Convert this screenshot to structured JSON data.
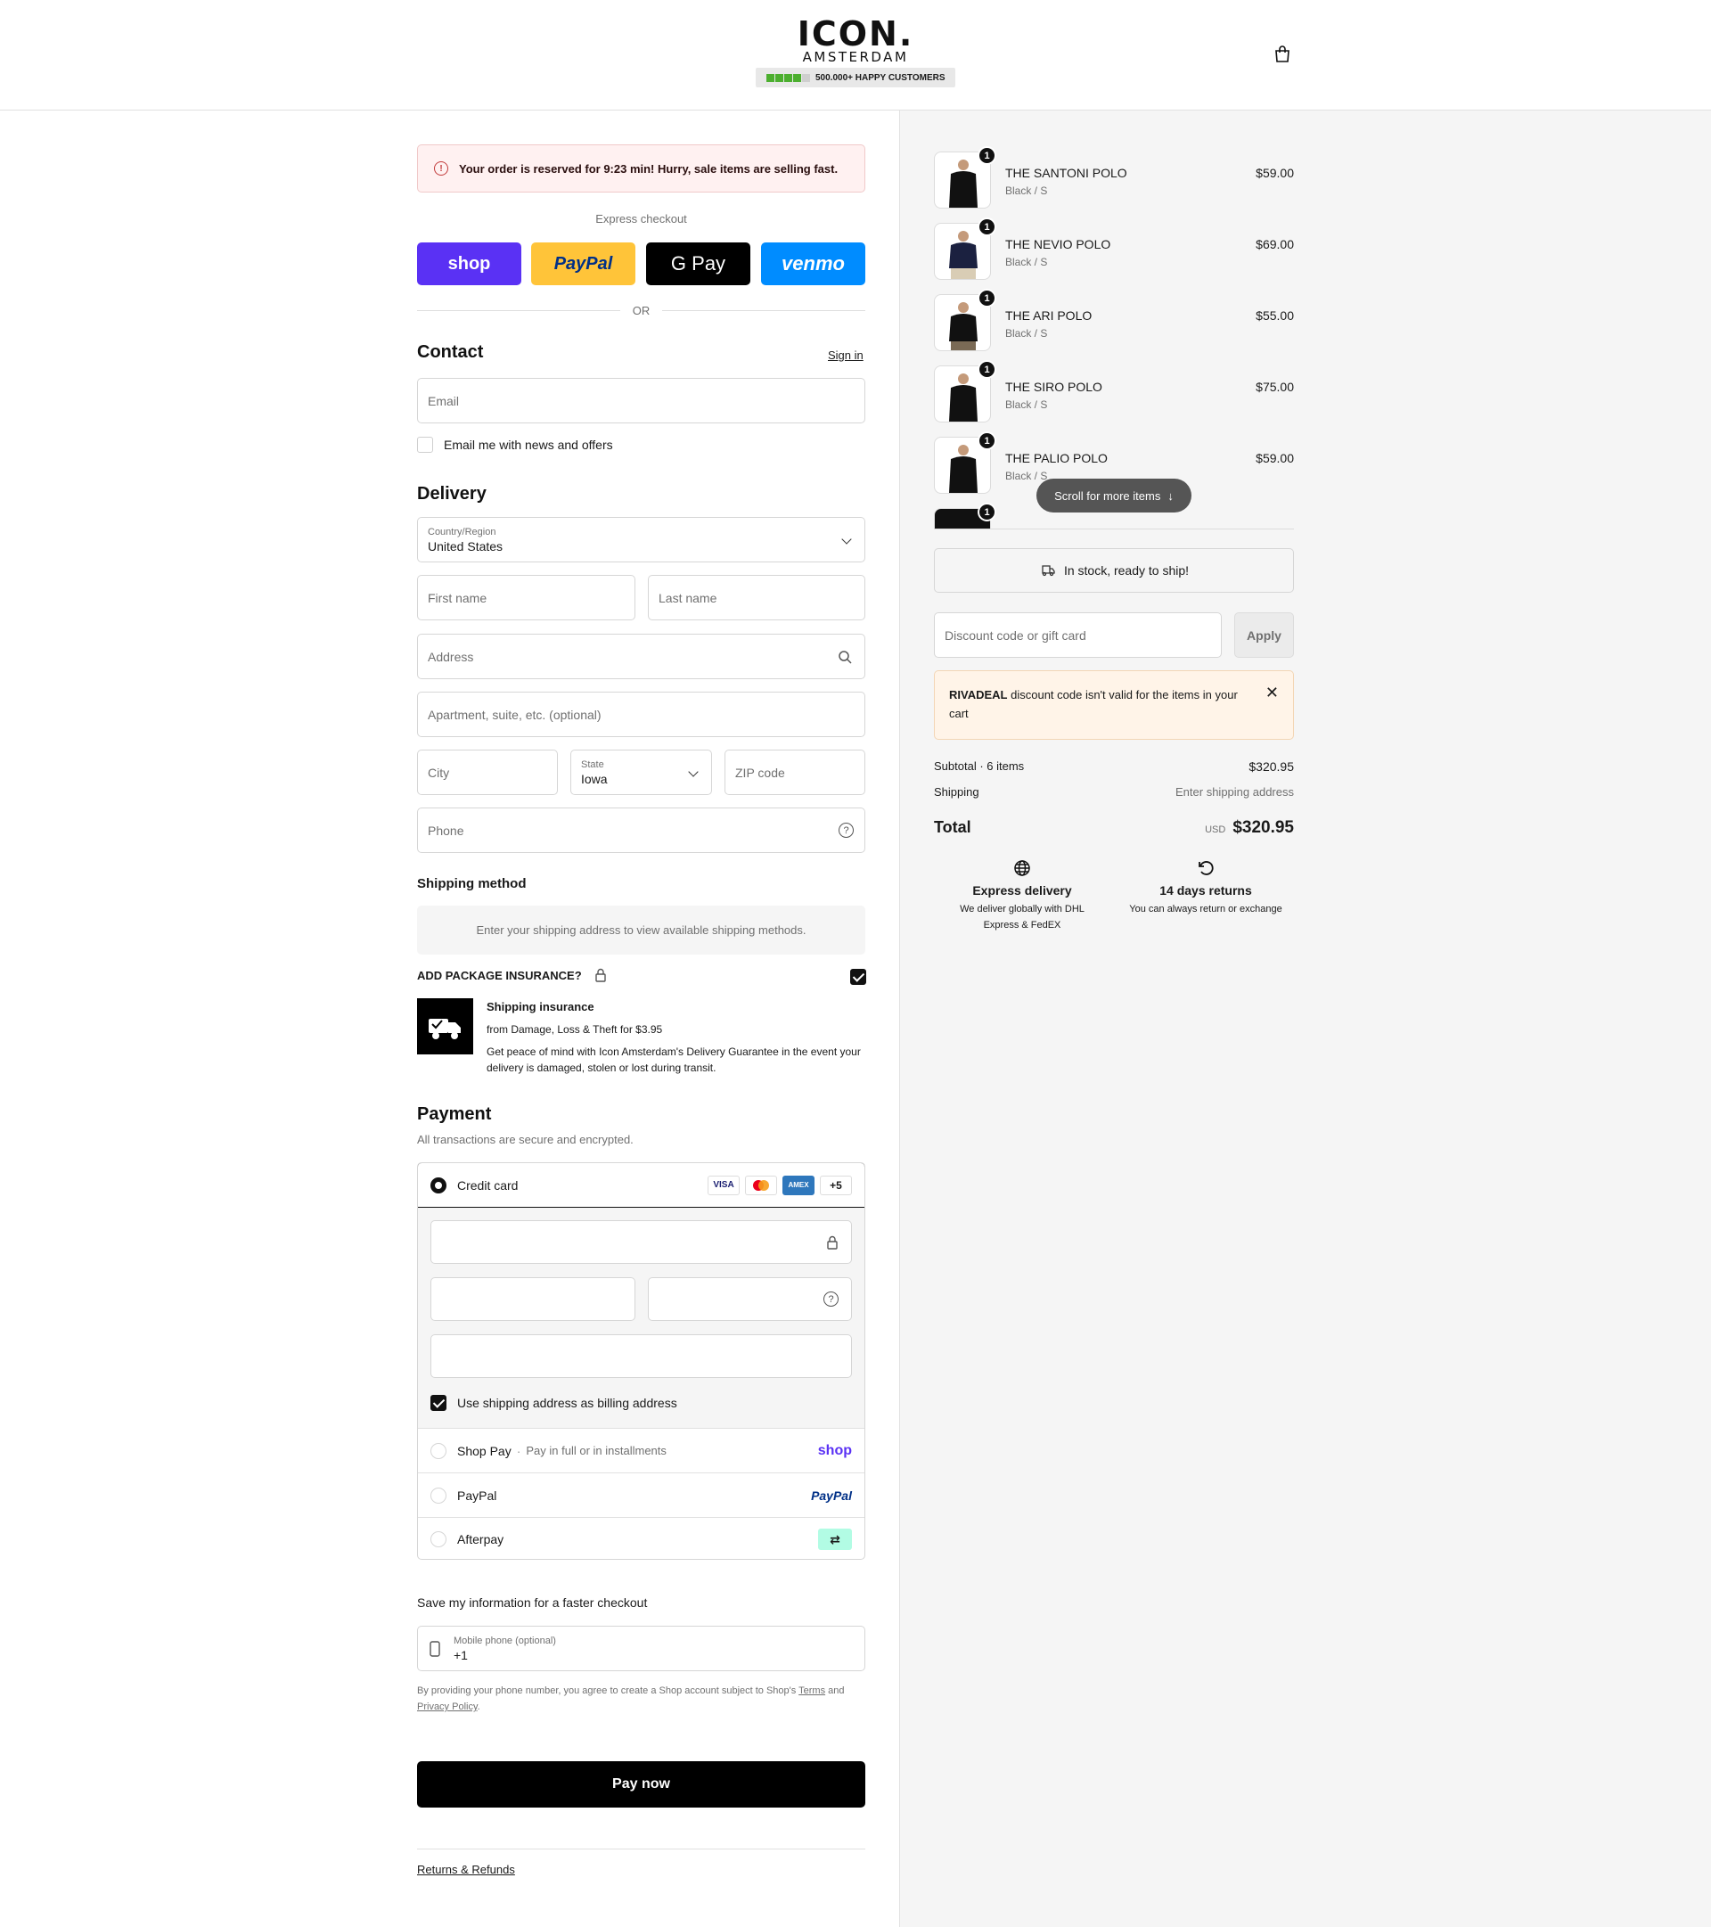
{
  "header": {
    "brand": "ICON.",
    "brand_sub": "AMSTERDAM",
    "trust_text": "500.000+ HAPPY CUSTOMERS",
    "rating_stars": 4,
    "cart_icon": "shopping-bag-icon"
  },
  "alert": {
    "text": "Your order is reserved for 9:23 min! Hurry, sale items are selling fast.",
    "icon": "alert-circle-icon"
  },
  "express": {
    "title": "Express checkout",
    "buttons": [
      "shop",
      "PayPal",
      "G Pay",
      "venmo"
    ],
    "or_label": "OR"
  },
  "contact": {
    "heading": "Contact",
    "sign_in": "Sign in",
    "email_placeholder": "Email",
    "news_label": "Email me with news and offers"
  },
  "delivery": {
    "heading": "Delivery",
    "country_label": "Country/Region",
    "country_value": "United States",
    "first_name": "First name",
    "last_name": "Last name",
    "address": "Address",
    "apartment": "Apartment, suite, etc. (optional)",
    "city": "City",
    "state_label": "State",
    "state_value": "Iowa",
    "zip": "ZIP code",
    "phone": "Phone"
  },
  "shipping_method": {
    "heading": "Shipping method",
    "notice": "Enter your shipping address to view available shipping methods."
  },
  "insurance": {
    "heading": "ADD PACKAGE INSURANCE?",
    "checked": true,
    "title": "Shipping insurance",
    "subtitle": "from Damage, Loss & Theft for $3.95",
    "description": "Get peace of mind with Icon Amsterdam's Delivery Guarantee in the event your delivery is damaged, stolen or lost during transit."
  },
  "payment": {
    "heading": "Payment",
    "subtitle": "All transactions are secure and encrypted.",
    "credit_card_label": "Credit card",
    "card_brands": [
      "VISA",
      "MC",
      "AMEX",
      "+5"
    ],
    "billing_label": "Use shipping address as billing address",
    "shop_pay_label": "Shop Pay",
    "shop_pay_sub": "Pay in full or in installments",
    "shop_pay_logo": "shop",
    "paypal_label": "PayPal",
    "paypal_logo": "PayPal",
    "afterpay_label": "Afterpay"
  },
  "save_info": {
    "heading": "Save my information for a faster checkout",
    "phone_label": "Mobile phone (optional)",
    "phone_value": "+1",
    "legal_prefix": "By providing your phone number, you agree to create a Shop account subject to Shop's",
    "terms": "Terms",
    "and": "and",
    "privacy": "Privacy Policy",
    "period": "."
  },
  "pay_now": "Pay now",
  "footer_link": "Returns & Refunds",
  "order": {
    "items": [
      {
        "name": "THE SANTONI POLO",
        "variant": "Black / S",
        "price": "$59.00",
        "qty": "1"
      },
      {
        "name": "THE NEVIO POLO",
        "variant": "Black / S",
        "price": "$69.00",
        "qty": "1"
      },
      {
        "name": "THE ARI POLO",
        "variant": "Black / S",
        "price": "$55.00",
        "qty": "1"
      },
      {
        "name": "THE SIRO POLO",
        "variant": "Black / S",
        "price": "$75.00",
        "qty": "1"
      },
      {
        "name": "THE PALIO POLO",
        "variant": "Black / S",
        "price": "$59.00",
        "qty": "1"
      }
    ],
    "hidden_qty": "1",
    "scroll_hint": "Scroll for more items",
    "stock_text": "In stock, ready to ship!",
    "discount_placeholder": "Discount code or gift card",
    "apply": "Apply",
    "discount_error_code": "RIVADEAL",
    "discount_error_text": "discount code isn't valid for the items in your cart",
    "subtotal_label": "Subtotal · 6 items",
    "subtotal_value": "$320.95",
    "shipping_label": "Shipping",
    "shipping_value": "Enter shipping address",
    "total_label": "Total",
    "currency": "USD",
    "total_value": "$320.95",
    "features": [
      {
        "icon": "globe-icon",
        "title": "Express delivery",
        "text": "We deliver globally with DHL Express & FedEX"
      },
      {
        "icon": "returns-icon",
        "title": "14 days returns",
        "text": "You can always return or exchange"
      }
    ]
  }
}
